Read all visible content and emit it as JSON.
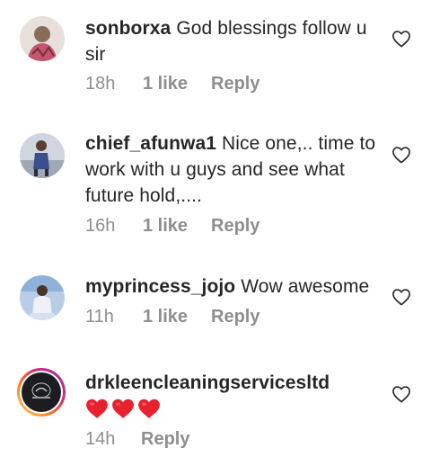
{
  "comments": [
    {
      "username": "sonborxa",
      "text": "God blessings follow u sir",
      "time": "18h",
      "likes": "1 like",
      "reply": "Reply"
    },
    {
      "username": "chief_afunwa1",
      "text": "Nice one,.. time to work with u guys and see what future hold,....",
      "time": "16h",
      "likes": "1 like",
      "reply": "Reply"
    },
    {
      "username": "myprincess_jojo",
      "text": "Wow awesome",
      "time": "11h",
      "likes": "1 like",
      "reply": "Reply"
    },
    {
      "username": "drkleencleaningservicesltd",
      "text": "❤️❤️❤️",
      "time": "14h",
      "reply": "Reply"
    }
  ],
  "colors": {
    "text": "#262626",
    "muted": "#8e8e8e",
    "heart_emoji": "#e8212e",
    "story_ring": "#d62976"
  },
  "icons": {
    "like": "heart-outline-icon",
    "emoji": "red-heart-emoji"
  }
}
